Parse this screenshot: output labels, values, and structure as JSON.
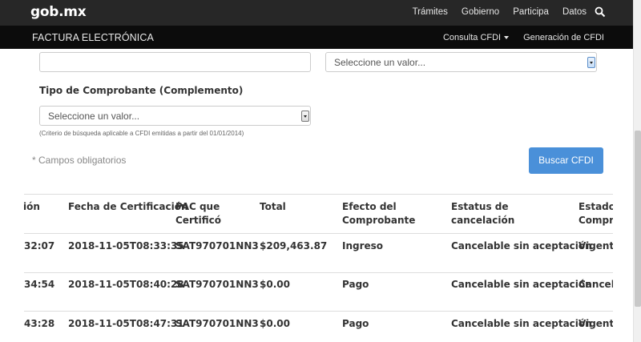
{
  "header": {
    "brand": "gob.mx",
    "nav": [
      "Trámites",
      "Gobierno",
      "Participa",
      "Datos"
    ]
  },
  "subheader": {
    "title": "FACTURA ELECTRÓNICA",
    "nav": [
      "Consulta CFDI",
      "Generación de CFDI"
    ]
  },
  "form": {
    "top_select_placeholder": "Seleccione un valor...",
    "tipo_label": "Tipo de Comprobante (Complemento)",
    "tipo_select_placeholder": "Seleccione un valor...",
    "hint": "(Criterio de búsqueda aplicable a CFDI emitidas a partir del 01/01/2014)",
    "required_note": "* Campos obligatorios",
    "search_button": "Buscar CFDI"
  },
  "table": {
    "headers": [
      [
        "ión"
      ],
      [
        "Fecha de Certificación"
      ],
      [
        "PAC que",
        "Certificó"
      ],
      [
        "Total"
      ],
      [
        "Efecto del",
        "Comprobante"
      ],
      [
        "Estatus de",
        "cancelación"
      ],
      [
        "Estado",
        "Compro"
      ]
    ],
    "rows": [
      [
        "32:07",
        "2018-11-05T08:33:35",
        "SAT970701NN3",
        "$209,463.87",
        "Ingreso",
        "Cancelable sin aceptación",
        "Vigente"
      ],
      [
        "34:54",
        "2018-11-05T08:40:28",
        "SAT970701NN3",
        "$0.00",
        "Pago",
        "Cancelable sin aceptación",
        "Cancela"
      ],
      [
        "43:28",
        "2018-11-05T08:47:31",
        "SAT970701NN3",
        "$0.00",
        "Pago",
        "Cancelable sin aceptación",
        "Vigente"
      ]
    ]
  },
  "colors": {
    "topbar": "#272727",
    "subbar": "#0c0c0c",
    "primary_button": "#4a90d9"
  }
}
